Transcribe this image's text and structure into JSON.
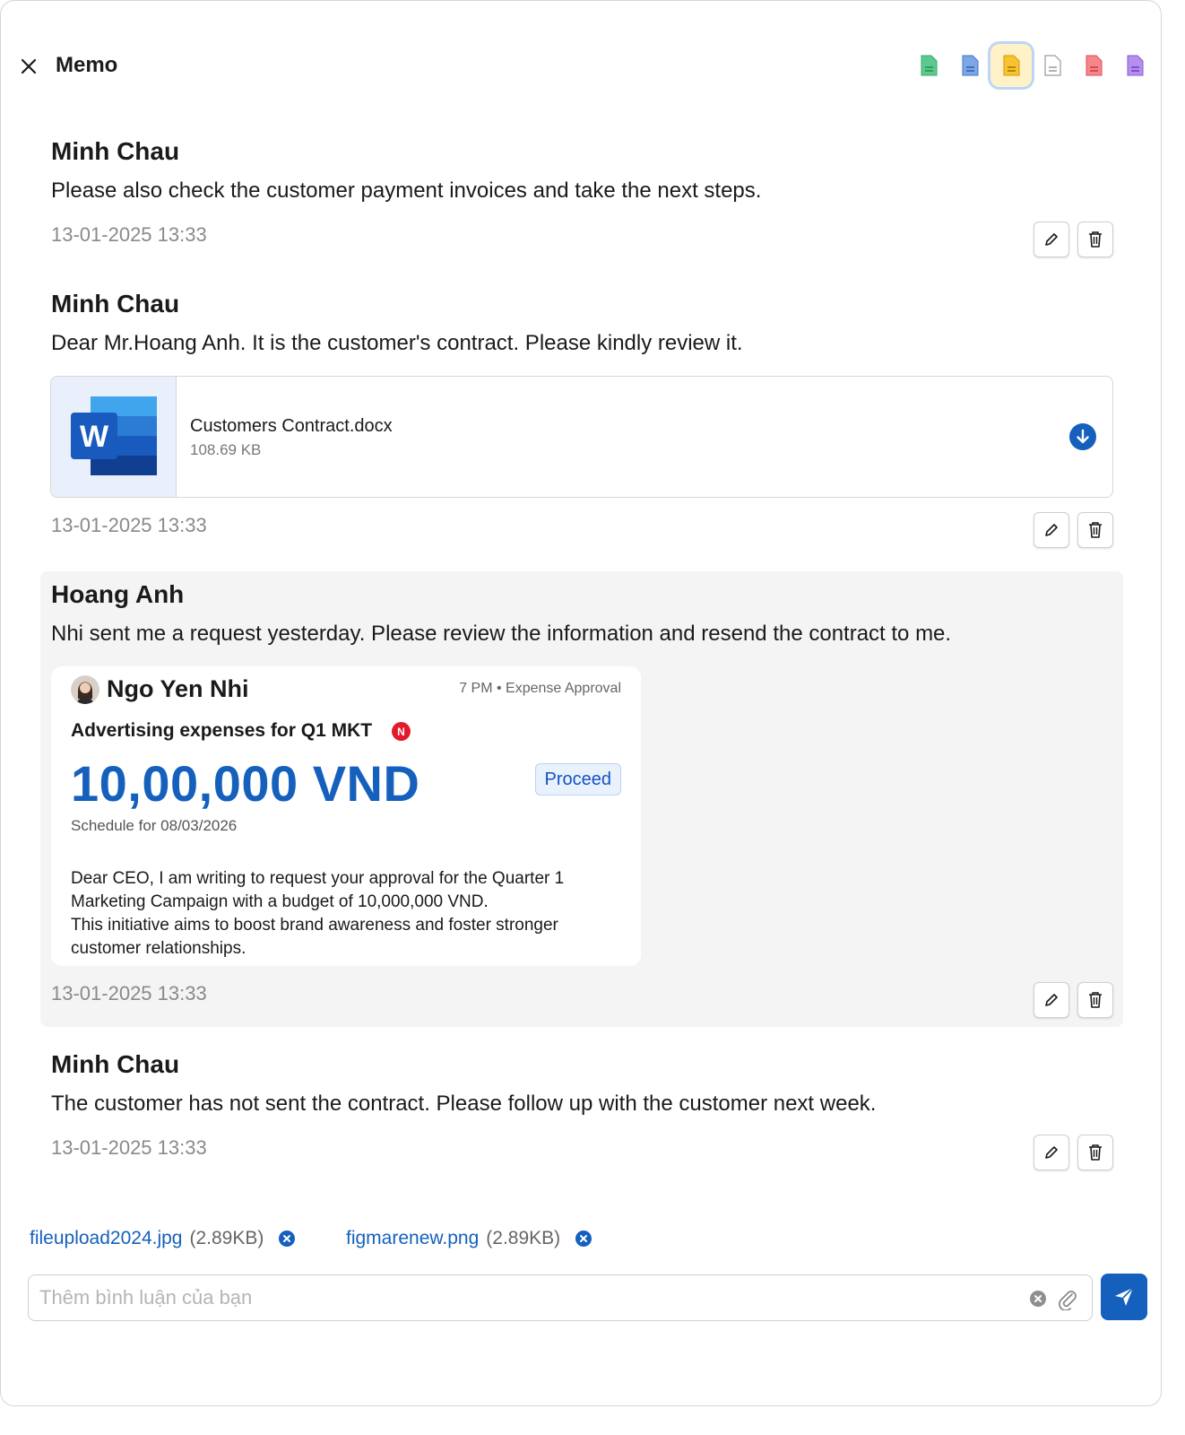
{
  "header": {
    "title": "Memo",
    "close_icon": "close-icon",
    "note_colors": [
      {
        "name": "green",
        "hex": "#5cc98e"
      },
      {
        "name": "blue",
        "hex": "#5b8fd9"
      },
      {
        "name": "yellow",
        "hex": "#f3b514",
        "selected": true
      },
      {
        "name": "white",
        "hex": "#ffffff"
      },
      {
        "name": "red",
        "hex": "#f06f76"
      },
      {
        "name": "purple",
        "hex": "#a774e6"
      }
    ]
  },
  "memos": [
    {
      "author": "Minh Chau",
      "text": "Please also check the customer payment invoices and take the next steps.",
      "time": "13-01-2025 13:33"
    },
    {
      "author": "Minh Chau",
      "text": "Dear Mr.Hoang Anh. It is the customer's contract. Please kindly review it.",
      "attachment": {
        "file_name": "Customers Contract.docx",
        "file_size": "108.69 KB",
        "icon": "word-file-icon"
      },
      "time": "13-01-2025 13:33"
    },
    {
      "author": "Hoang Anh",
      "text": "Nhi sent me a request yesterday. Please review the information and resend the contract to me.",
      "card": {
        "sender": "Ngo Yen Nhi",
        "meta": "7 PM • Expense Approval",
        "subject": "Advertising expenses for Q1 MKT",
        "badge": "N",
        "amount": "10,00,000 VND",
        "status": "Proceed",
        "schedule": "Schedule for 08/03/2026",
        "body_line1": "Dear CEO, I am writing to request your approval for the Quarter 1 Marketing Campaign with a budget of 10,000,000 VND.",
        "body_line2": "This initiative aims to boost brand awareness and foster stronger customer relationships."
      },
      "time": "13-01-2025 13:33"
    },
    {
      "author": "Minh Chau",
      "text": "The customer has not sent the contract. Please follow up with the customer next week.",
      "time": "13-01-2025 13:33"
    }
  ],
  "uploads": [
    {
      "name": "fileupload2024.jpg",
      "size": "(2.89KB)"
    },
    {
      "name": "figmarenew.png",
      "size": "(2.89KB)"
    }
  ],
  "comment": {
    "placeholder": "Thêm bình luận của bạn",
    "value": ""
  },
  "colors": {
    "accent": "#1560bd",
    "muted_text": "#8a8a8a",
    "highlight_bg": "#f4f4f4"
  }
}
